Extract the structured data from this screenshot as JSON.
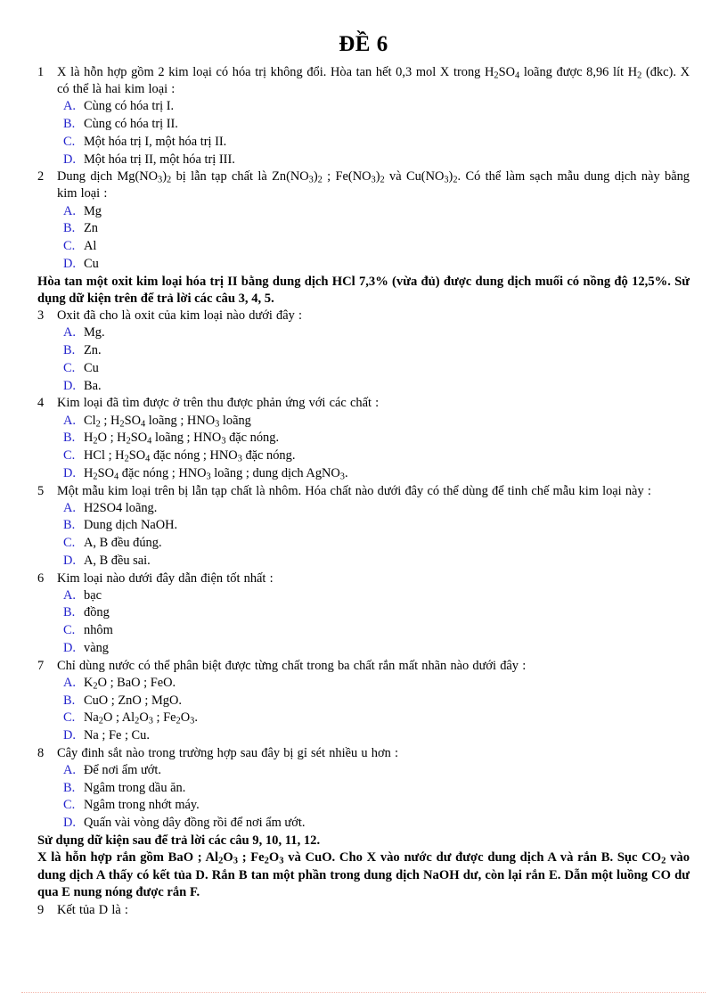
{
  "document": {
    "title": "ĐỀ 6",
    "accent_option_color": "#2222cc",
    "footer_rule_color": "#f4b9ae"
  },
  "items": [
    {
      "kind": "question",
      "number": "1",
      "text_html": "X là hỗn hợp gồm 2 kim loại có hóa trị không đổi. Hòa tan hết 0,3 mol X trong H<sub>2</sub>SO<sub>4</sub> loãng được 8,96 lít H<sub>2</sub> (đkc). X có thể là hai kim loại :",
      "options": [
        {
          "letter": "A.",
          "text_html": "Cùng có hóa trị I."
        },
        {
          "letter": "B.",
          "text_html": "Cùng có hóa trị II."
        },
        {
          "letter": "C.",
          "text_html": "Một hóa trị I, một hóa trị II."
        },
        {
          "letter": "D.",
          "text_html": "Một hóa trị II, một hóa trị III."
        }
      ]
    },
    {
      "kind": "question",
      "number": "2",
      "text_html": "Dung dịch Mg(NO<sub>3</sub>)<sub>2</sub> bị lẫn tạp chất là Zn(NO<sub>3</sub>)<sub>2</sub> ; Fe(NO<sub>3</sub>)<sub>2</sub> và Cu(NO<sub>3</sub>)<sub>2</sub>. Có thể làm sạch mẫu dung dịch này bằng kim loại :",
      "options": [
        {
          "letter": "A.",
          "text_html": "Mg"
        },
        {
          "letter": "B.",
          "text_html": "Zn"
        },
        {
          "letter": "C.",
          "text_html": "Al"
        },
        {
          "letter": "D.",
          "text_html": "Cu"
        }
      ]
    },
    {
      "kind": "paragraph",
      "text_html": "Hòa tan một oxit kim loại hóa trị II bằng dung dịch HCl 7,3% (vừa đủ) được dung dịch muối có nồng độ 12,5%. Sử dụng dữ kiện trên để trả lời các câu 3, 4, 5."
    },
    {
      "kind": "question",
      "number": "3",
      "text_html": "Oxit đã cho là oxit của kim loại nào dưới đây :",
      "options": [
        {
          "letter": "A.",
          "text_html": "Mg."
        },
        {
          "letter": "B.",
          "text_html": "Zn."
        },
        {
          "letter": "C.",
          "text_html": "Cu"
        },
        {
          "letter": "D.",
          "text_html": "Ba."
        }
      ]
    },
    {
      "kind": "question",
      "number": "4",
      "text_html": "Kim loại đã tìm được ở trên thu được phản ứng với các chất :",
      "options": [
        {
          "letter": "A.",
          "text_html": "Cl<sub>2</sub> ; H<sub>2</sub>SO<sub>4</sub> loãng ; HNO<sub>3</sub> loãng"
        },
        {
          "letter": "B.",
          "text_html": "H<sub>2</sub>O ; H<sub>2</sub>SO<sub>4</sub> loãng ; HNO<sub>3</sub> đặc nóng."
        },
        {
          "letter": "C.",
          "text_html": "HCl ; H<sub>2</sub>SO<sub>4</sub> đặc nóng ; HNO<sub>3</sub> đặc nóng."
        },
        {
          "letter": "D.",
          "text_html": "H<sub>2</sub>SO<sub>4</sub> đặc nóng ; HNO<sub>3</sub> loãng ; dung dịch AgNO<sub>3</sub>."
        }
      ]
    },
    {
      "kind": "question",
      "number": "5",
      "text_html": "Một mẫu kim loại trên bị lẫn tạp chất là nhôm. Hóa chất nào dưới đây có thể dùng để tinh chế mẫu kim loại này :",
      "options": [
        {
          "letter": "A.",
          "text_html": "H2SO4 loãng."
        },
        {
          "letter": "B.",
          "text_html": "Dung dịch NaOH."
        },
        {
          "letter": "C.",
          "text_html": "A, B đều đúng."
        },
        {
          "letter": "D.",
          "text_html": "A, B đều sai."
        }
      ]
    },
    {
      "kind": "question",
      "number": "6",
      "text_html": "Kim loại nào dưới đây dẫn điện tốt nhất :",
      "options": [
        {
          "letter": "A.",
          "text_html": "bạc"
        },
        {
          "letter": "B.",
          "text_html": "đồng"
        },
        {
          "letter": "C.",
          "text_html": "nhôm"
        },
        {
          "letter": "D.",
          "text_html": "vàng"
        }
      ]
    },
    {
      "kind": "question",
      "number": "7",
      "text_html": "Chỉ dùng nước có thể phân biệt được từng chất trong ba chất rắn mất nhãn nào dưới đây :",
      "options": [
        {
          "letter": "A.",
          "text_html": "K<sub>2</sub>O ; BaO ; FeO."
        },
        {
          "letter": "B.",
          "text_html": "CuO ; ZnO ; MgO."
        },
        {
          "letter": "C.",
          "text_html": "Na<sub>2</sub>O ; Al<sub>2</sub>O<sub>3</sub> ; Fe<sub>2</sub>O<sub>3</sub>."
        },
        {
          "letter": "D.",
          "text_html": "Na ; Fe ; Cu."
        }
      ]
    },
    {
      "kind": "question",
      "number": "8",
      "text_html": "Cây đinh sắt nào trong trường hợp sau đây bị gỉ sét nhiều u hơn :",
      "options": [
        {
          "letter": "A.",
          "text_html": "Để nơi ẩm ướt."
        },
        {
          "letter": "B.",
          "text_html": "Ngâm trong dầu ăn."
        },
        {
          "letter": "C.",
          "text_html": "Ngâm trong nhớt máy."
        },
        {
          "letter": "D.",
          "text_html": "Quấn vài vòng dây đồng rồi để nơi ẩm ướt."
        }
      ]
    },
    {
      "kind": "paragraph",
      "align": "left",
      "text_html": "Sử dụng dữ kiện sau để trả lời các câu 9, 10, 11, 12."
    },
    {
      "kind": "paragraph",
      "text_html": "X là hỗn hợp rắn gồm BaO ; Al<sub>2</sub>O<sub>3</sub> ; Fe<sub>2</sub>O<sub>3</sub> và CuO. Cho X vào nước dư được dung dịch A và rắn B. Sục CO<sub>2</sub> vào dung dịch A thấy có kết tủa D. Rắn B tan một phần trong dung dịch NaOH dư, còn lại rắn E. Dẫn một luồng CO dư qua E nung nóng được rắn F."
    },
    {
      "kind": "question",
      "number": "9",
      "text_html": "Kết tủa D là :",
      "options": []
    }
  ]
}
